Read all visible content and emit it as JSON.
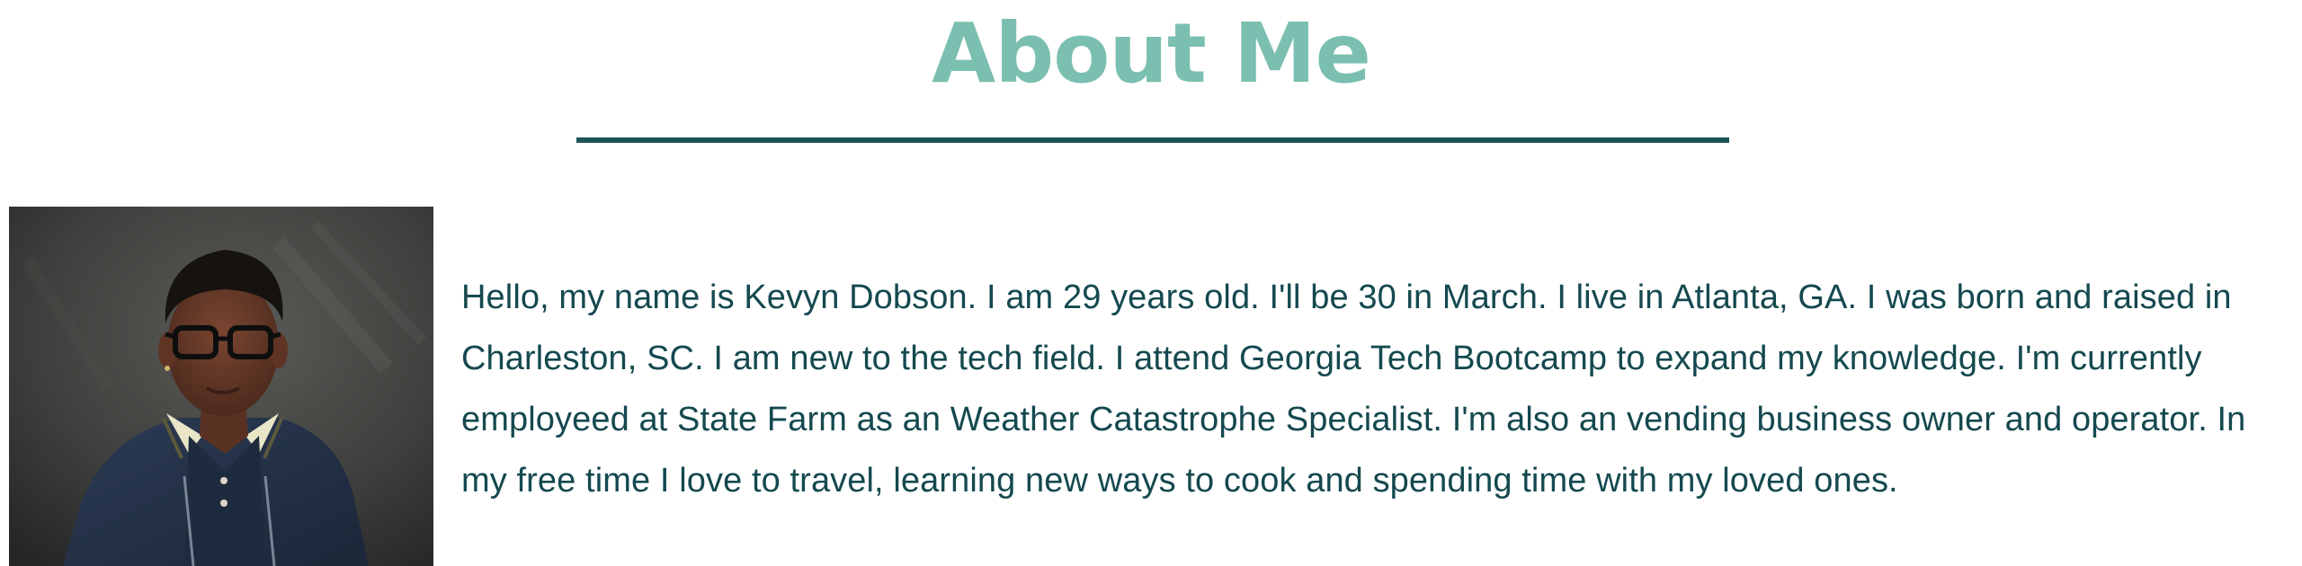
{
  "about": {
    "title": "About Me",
    "bio": "Hello, my name is Kevyn Dobson. I am 29 years old. I'll be 30 in March. I live in Atlanta, GA. I was born and raised in Charleston, SC. I am new to the tech field. I attend Georgia Tech Bootcamp to expand my knowledge. I'm currently employeed at State Farm as an Weather Catastrophe Specialist. I'm also an vending business owner and operator. In my free time I love to travel, learning new ways to cook and spending time with my loved ones.",
    "photo_icon": "profile-photo"
  },
  "colors": {
    "title": "#7bbfb0",
    "divider": "#1c5458",
    "bio_text": "#14494f",
    "photo_background": "#3f3f3d",
    "jacket": "#253349",
    "skin": "#6a3d2b"
  }
}
